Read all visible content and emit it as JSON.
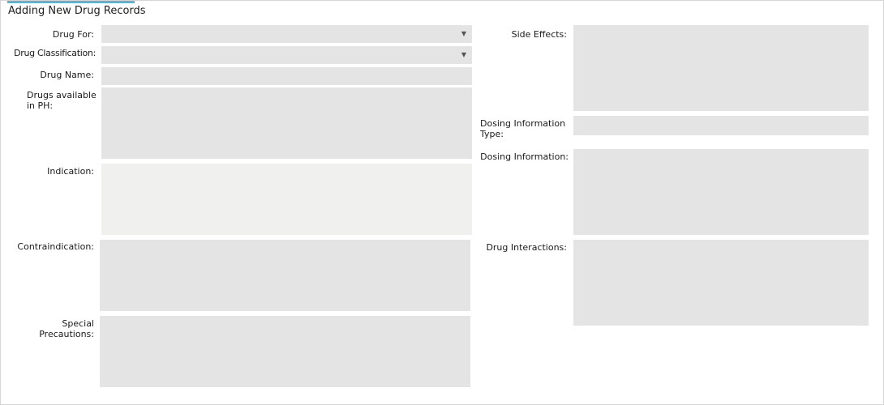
{
  "page": {
    "title": "Adding New Drug Records"
  },
  "form": {
    "drug_for": {
      "label": "Drug For:",
      "value": "",
      "arrow_icon": "chevron-down-icon"
    },
    "drug_classification": {
      "label": "Drug Classification:",
      "value": "",
      "arrow_icon": "chevron-down-icon"
    },
    "drug_name": {
      "label": "Drug Name:",
      "value": ""
    },
    "drugs_available": {
      "label_line1": "Drugs available",
      "label_line2": "in PH:",
      "value": ""
    },
    "indication": {
      "label": "Indication:",
      "value": ""
    },
    "contraindication": {
      "label": "Contraindication:",
      "value": ""
    },
    "special_precautions": {
      "label": "Special Precautions:",
      "value": ""
    },
    "side_effects": {
      "label": "Side Effects:",
      "value": ""
    },
    "dosing_info_type": {
      "label_line1": "Dosing Information",
      "label_line2": "Type:",
      "value": ""
    },
    "dosing_info": {
      "label": "Dosing Information:",
      "value": ""
    },
    "drug_interactions": {
      "label": "Drug Interactions:",
      "value": ""
    }
  },
  "colors": {
    "accent": "#4cb8e6",
    "field_bg": "#e4e4e4",
    "field_bg_light": "#f0f1ef"
  }
}
